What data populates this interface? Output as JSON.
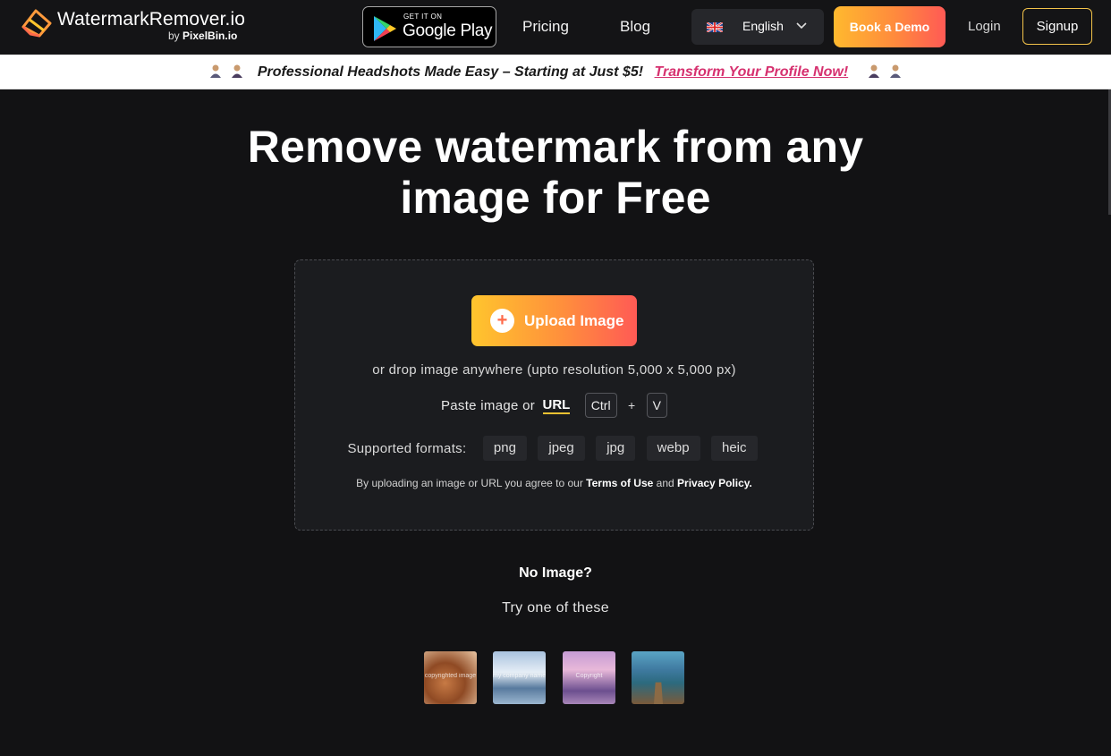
{
  "header": {
    "logo_name": "WatermarkRemover.io",
    "logo_by": "by",
    "logo_by_brand": "PixelBin.io",
    "google_play_small": "GET IT ON",
    "google_play_big": "Google Play",
    "nav": {
      "pricing": "Pricing",
      "blog": "Blog"
    },
    "language": "English",
    "book_demo": "Book a Demo",
    "login": "Login",
    "signup": "Signup"
  },
  "promo": {
    "text": "Professional Headshots Made Easy – Starting at Just $5!",
    "link": "Transform Your Profile Now!"
  },
  "hero": {
    "title_line1": "Remove watermark from any",
    "title_line2": "image for Free"
  },
  "upload": {
    "button_icon": "+",
    "button_label": "Upload Image",
    "drop_text": "or drop image anywhere (upto resolution 5,000 x 5,000 px)",
    "paste_text": "Paste image or",
    "paste_url": "URL",
    "key_ctrl": "Ctrl",
    "key_plus": "+",
    "key_v": "V",
    "formats_label": "Supported formats:",
    "formats": [
      "png",
      "jpeg",
      "jpg",
      "webp",
      "heic"
    ],
    "terms_prefix": "By uploading an image or URL you agree to our",
    "terms_of_use": "Terms of Use",
    "terms_and": "and",
    "privacy_policy": "Privacy Policy."
  },
  "samples": {
    "heading": "No Image?",
    "subheading": "Try one of these",
    "items": [
      {
        "watermark": "copyrighted image"
      },
      {
        "watermark": "my company name"
      },
      {
        "watermark": "Copyright"
      },
      {
        "watermark": ""
      }
    ]
  },
  "colors": {
    "background": "#121214",
    "accent_gradient_start": "#ffc52d",
    "accent_gradient_end": "#ff5a55",
    "promo_link": "#d6316f",
    "signup_border": "#f3c34a"
  }
}
